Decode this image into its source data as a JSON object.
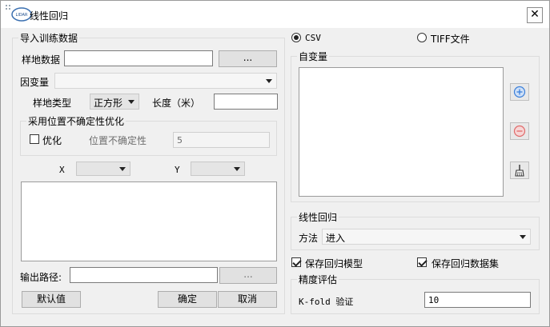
{
  "window": {
    "title": "线性回归",
    "close_glyph": "✕",
    "logo_text": "LIDAR"
  },
  "train": {
    "group_title": "导入训练数据",
    "plot_data_label": "样地数据",
    "plot_data_value": "",
    "browse_label": "...",
    "dependent_label": "因变量",
    "dependent_value": "",
    "plot_type_label": "样地类型",
    "plot_type_value": "正方形",
    "length_label": "长度（米）",
    "length_value": ""
  },
  "uncertainty": {
    "group_title": "采用位置不确定性优化",
    "optimize_label": "优化",
    "optimize_checked": false,
    "uncertainty_label": "位置不确定性",
    "uncertainty_value": "5"
  },
  "coords": {
    "x_label": "X",
    "y_label": "Y",
    "x_value": "",
    "y_value": ""
  },
  "output": {
    "path_label": "输出路径:",
    "path_value": "",
    "browse_label": "..."
  },
  "buttons": {
    "default_label": "默认值",
    "ok_label": "确定",
    "cancel_label": "取消"
  },
  "source": {
    "csv_label": "CSV",
    "tiff_label": "TIFF文件",
    "selected": "csv"
  },
  "independent": {
    "group_title": "自变量",
    "icons": [
      "add-icon",
      "remove-icon",
      "clear-icon"
    ]
  },
  "regression": {
    "group_title": "线性回归",
    "method_label": "方法",
    "method_value": "进入"
  },
  "save": {
    "model_label": "保存回归模型",
    "model_checked": true,
    "dataset_label": "保存回归数据集",
    "dataset_checked": true
  },
  "accuracy": {
    "group_title": "精度评估",
    "kfold_label": "K-fold 验证",
    "kfold_value": "10"
  },
  "colors": {
    "add_icon": "#3b7fd9",
    "remove_icon": "#e06a6a"
  }
}
